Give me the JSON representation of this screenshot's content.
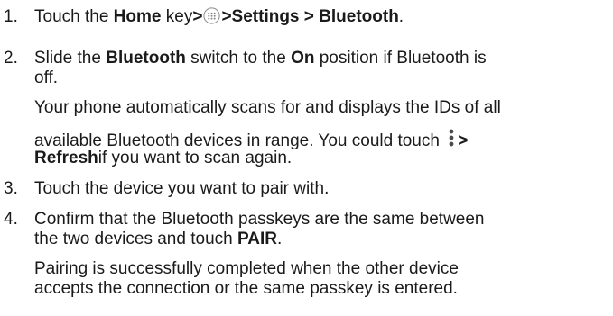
{
  "steps": [
    {
      "number": "1.",
      "prefix": "Touch the ",
      "home_key": "Home",
      "key_word": " key",
      "arrow1": ">",
      "apps_icon": "apps-grid-icon",
      "arrow2": ">",
      "path": "Settings > Bluetooth",
      "suffix": "."
    },
    {
      "number": "2.",
      "line1_prefix": "Slide the ",
      "line1_bold1": "Bluetooth",
      "line1_mid": " switch to the ",
      "line1_bold2": "On",
      "line1_suffix": " position if Bluetooth is",
      "line2": "off.",
      "note_line1": "Your phone automatically scans for and displays the IDs of all",
      "note_line2_prefix": "available Bluetooth devices in range. You could touch ",
      "menu_icon": "overflow-menu-icon",
      "note_line2_arrow": ">",
      "note_line3_bold": "Refresh",
      "note_line3_suffix": "if you want to scan again."
    },
    {
      "number": "3.",
      "text": "Touch the device you want to pair with."
    },
    {
      "number": "4.",
      "line1": "Confirm that the Bluetooth passkeys are the same between",
      "line2_prefix": "the two devices and touch ",
      "line2_bold": "PAIR",
      "line2_suffix": ".",
      "note_line1": "Pairing is successfully completed when the other device",
      "note_line2": "accepts the connection or the same passkey is entered."
    }
  ]
}
